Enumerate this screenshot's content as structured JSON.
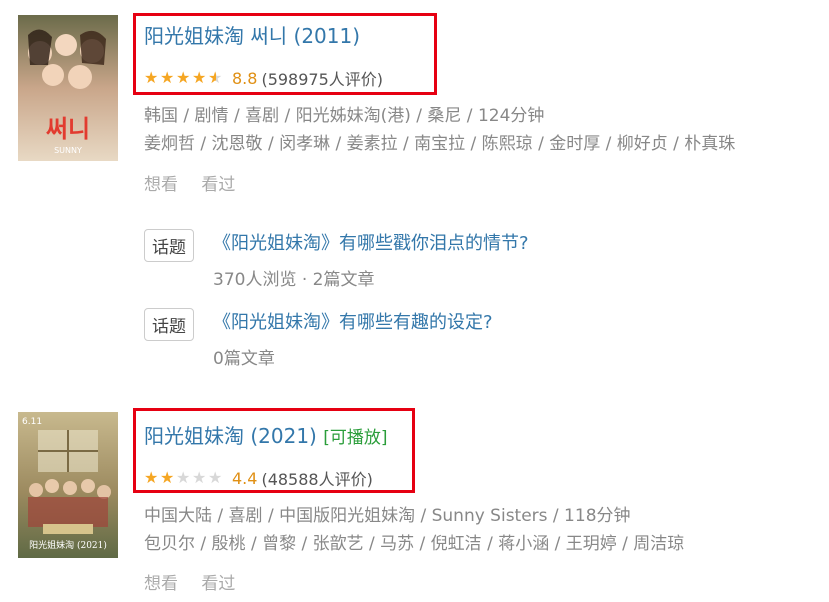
{
  "movies": [
    {
      "title": "阳光姐妹淘 써니 (2011)",
      "playable": "",
      "stars_value": 4.5,
      "score": "8.8",
      "ratings": "(598975人评价)",
      "meta_line1": "韩国 / 剧情 / 喜剧 / 阳光姊妹淘(港) / 桑尼 / 124分钟",
      "meta_line2": "姜炯哲 / 沈恩敬 / 闵孝琳 / 姜素拉 / 南宝拉 / 陈熙琼 / 金时厚 / 柳好贞 / 朴真珠",
      "want": "想看",
      "seen": "看过",
      "poster_text": "써니",
      "poster_sub": "SUNNY"
    },
    {
      "title": "阳光姐妹淘 (2021)",
      "playable": "[可播放]",
      "stars_value": 2.0,
      "score": "4.4",
      "ratings": "(48588人评价)",
      "meta_line1": "中国大陆 / 喜剧 / 中国版阳光姐妹淘 / Sunny Sisters / 118分钟",
      "meta_line2": "包贝尔 / 殷桃 / 曾黎 / 张歆艺 / 马苏 / 倪虹洁 / 蒋小涵 / 王玥婷 / 周洁琼",
      "want": "想看",
      "seen": "看过",
      "poster_text": "6.11"
    }
  ],
  "topics": [
    {
      "tag": "话题",
      "title": "《阳光姐妹淘》有哪些戳你泪点的情节?",
      "sub": "370人浏览 · 2篇文章"
    },
    {
      "tag": "话题",
      "title": "《阳光姐妹淘》有哪些有趣的设定?",
      "sub": "0篇文章"
    }
  ],
  "colors": {
    "link": "#3377aa",
    "highlight": "#e60012",
    "star": "#f5a623",
    "playable": "#2a9d3a"
  }
}
